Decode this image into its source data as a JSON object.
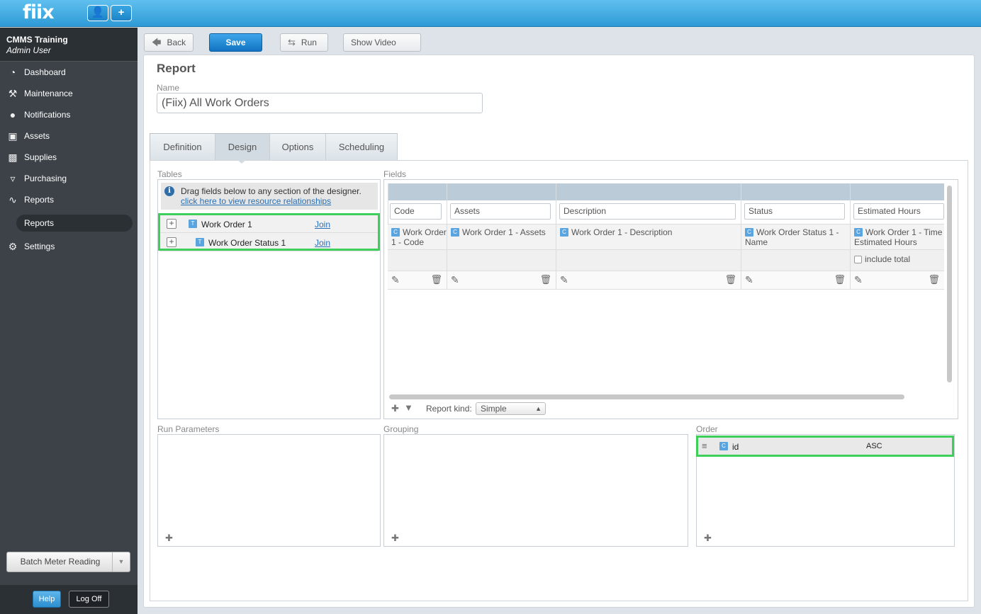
{
  "app": {
    "logo": "fiix",
    "user_icon": "user-icon",
    "add_icon": "plus-icon",
    "add_label": "+"
  },
  "sidebar": {
    "org_name": "CMMS Training",
    "user_name": "Admin User",
    "items": [
      {
        "label": "Dashboard",
        "icon": "dashboard-icon"
      },
      {
        "label": "Maintenance",
        "icon": "wrench-icon"
      },
      {
        "label": "Notifications",
        "icon": "speech-bubble-icon"
      },
      {
        "label": "Assets",
        "icon": "box-icon"
      },
      {
        "label": "Supplies",
        "icon": "truck-icon"
      },
      {
        "label": "Purchasing",
        "icon": "cart-icon"
      },
      {
        "label": "Reports",
        "icon": "chart-icon"
      },
      {
        "label": "Settings",
        "icon": "gear-icon"
      }
    ],
    "sub_item": "Reports",
    "batch_label": "Batch Meter Reading",
    "help_label": "Help",
    "logoff_label": "Log Off"
  },
  "toolbar": {
    "back": "Back",
    "save": "Save",
    "run": "Run",
    "video_help": "Show Video Help"
  },
  "report": {
    "title": "Report",
    "name_label": "Name",
    "name_value": "(Fiix) All Work Orders"
  },
  "tabs": [
    "Definition",
    "Design",
    "Options",
    "Scheduling"
  ],
  "active_tab": "Design",
  "tables": {
    "label": "Tables",
    "info_text": "Drag fields below to any section of the designer.",
    "info_link": "click here to view resource relationships",
    "rows": [
      {
        "name": "Work Order 1",
        "join": "Join"
      },
      {
        "name": "Work Order Status 1",
        "join": "Join"
      }
    ]
  },
  "fields": {
    "label": "Fields",
    "columns": [
      {
        "header": "Code",
        "value": "Work Order 1 - Code"
      },
      {
        "header": "Assets",
        "value": "Work Order 1 - Assets"
      },
      {
        "header": "Description",
        "value": "Work Order 1 - Description"
      },
      {
        "header": "Status",
        "value": "Work Order Status 1 - Name"
      },
      {
        "header": "Estimated Hours",
        "value": "Work Order 1 - Time Estimated Hours"
      }
    ],
    "include_total": "include total",
    "report_kind_label": "Report kind:",
    "report_kind_value": "Simple"
  },
  "run_parameters": {
    "label": "Run Parameters"
  },
  "grouping": {
    "label": "Grouping"
  },
  "order": {
    "label": "Order",
    "rows": [
      {
        "field": "id",
        "dir": "ASC"
      }
    ]
  }
}
